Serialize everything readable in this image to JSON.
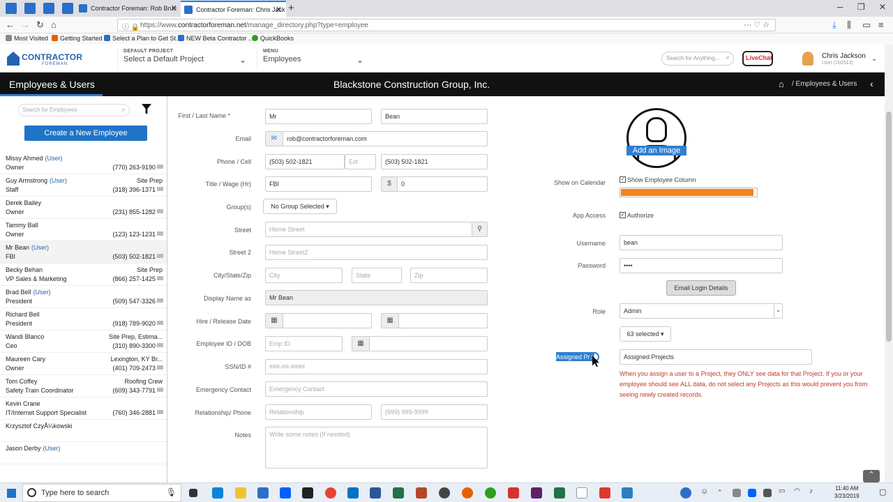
{
  "browser": {
    "tabs": [
      {
        "label": "Contractor Foreman: Rob Bruc",
        "active": false
      },
      {
        "label": "Contractor Foreman: Chris Jack",
        "active": true
      }
    ],
    "url_prefix": "https://www.",
    "url_host": "contractorforeman.net",
    "url_path": "/manage_directory.php?type=employee",
    "bookmarks": [
      "Most Visited",
      "Getting Started",
      "Select a Plan to Get St...",
      "NEW Beta Contractor ...",
      "QuickBooks"
    ]
  },
  "header": {
    "logo_text": "CONTRACTOR",
    "logo_sub": "FOREMAN",
    "project_caption": "DEFAULT PROJECT",
    "project_value": "Select a Default Project",
    "menu_caption": "MENU",
    "menu_value": "Employees",
    "search_placeholder": "Search for Anything...",
    "livechat": "LiveChat",
    "user_name": "Chris Jackson",
    "user_id": "User (102513)"
  },
  "titlebar": {
    "page_title": "Employees & Users",
    "company": "Blackstone Construction Group, Inc.",
    "breadcrumb": "/   Employees & Users"
  },
  "sidebar": {
    "search_placeholder": "Search for Employees",
    "create_button": "Create a New Employee",
    "user_tag": "(User)",
    "employees": [
      {
        "name": "Missy Ahmed",
        "user": true,
        "role": "Owner",
        "dept": "",
        "phone": "(770) 263-9190"
      },
      {
        "name": "Guy Armstrong",
        "user": true,
        "role": "Staff",
        "dept": "Site Prep",
        "phone": "(318) 396-1371"
      },
      {
        "name": "Derek Bailey",
        "user": false,
        "role": "Owner",
        "dept": "",
        "phone": "(231) 855-1282"
      },
      {
        "name": "Tammy Ball",
        "user": false,
        "role": "Owner",
        "dept": "",
        "phone": "(123) 123-1231"
      },
      {
        "name": "Mr Bean",
        "user": true,
        "role": "FBI",
        "dept": "",
        "phone": "(503) 502-1821",
        "selected": true
      },
      {
        "name": "Becky Behan",
        "user": false,
        "role": "VP Sales & Marketing",
        "dept": "Site Prep",
        "phone": "(866) 257-1425"
      },
      {
        "name": "Brad Bell",
        "user": true,
        "role": "President",
        "dept": "",
        "phone": "(509) 547-3326"
      },
      {
        "name": "Richard Bell",
        "user": false,
        "role": "President",
        "dept": "",
        "phone": "(918) 789-9020"
      },
      {
        "name": "Wandi Blanco",
        "user": false,
        "role": "Ceo",
        "dept": "Site Prep, Estima...",
        "phone": "(310) 890-3300"
      },
      {
        "name": "Maureen Cary",
        "user": false,
        "role": "Owner",
        "dept": "Lexington, KY Br...",
        "phone": "(401) 709-2473"
      },
      {
        "name": "Tom Coffey",
        "user": false,
        "role": "Safety Train Coordinator",
        "dept": "Roofing Crew",
        "phone": "(609) 343-7791"
      },
      {
        "name": "Kevin Crane",
        "user": false,
        "role": "IT/Internet Support Specialist",
        "dept": "",
        "phone": "(760) 346-2881"
      },
      {
        "name": "Krzysztof CzyÅ¼kowski",
        "user": false,
        "role": "",
        "dept": "",
        "phone": ""
      },
      {
        "name": "Jason Derby",
        "user": true,
        "role": "",
        "dept": "",
        "phone": ""
      }
    ]
  },
  "form": {
    "labels": {
      "name": "First /  Last Name *",
      "email": "Email",
      "phone": "Phone / Cell",
      "title": "Title / Wage (Hr)",
      "groups": "Group(s)",
      "street": "Street",
      "street2": "Street 2",
      "city": "City/State/Zip",
      "display": "Display Name as",
      "hire": "Hire / Release Date",
      "empid": "Employee ID / DOB",
      "ssn": "SSN/ID #",
      "emergency": "Emergency Contact",
      "relationship": "Relationship/ Phone",
      "notes": "Notes"
    },
    "first_name": "Mr",
    "last_name": "Bean",
    "email": "rob@contractorforeman.com",
    "phone": "(503) 502-1821",
    "ext_placeholder": "Ext",
    "cell": "(503) 502-1821",
    "title": "FBI",
    "wage_symbol": "$",
    "wage": "0",
    "groups_button": "No Group Selected",
    "street_placeholder": "Home Street",
    "street2_placeholder": "Home Street2",
    "city_placeholder": "City",
    "state_placeholder": "State",
    "zip_placeholder": "Zip",
    "display_name": "Mr Bean",
    "empid_placeholder": "Emp ID",
    "ssn_placeholder": "###-##-####",
    "emergency_placeholder": "Emergency Contact",
    "relationship_placeholder": "Relationship",
    "relationship_phone_placeholder": "(999) 999-9999",
    "notes_placeholder": "Write some notes (If needed)"
  },
  "right": {
    "add_image": "Add an Image",
    "show_calendar_label": "Show on Calendar",
    "show_column_text": "Show Employee Column",
    "calendar_color": "#f5821f",
    "app_access_label": "App Access",
    "authorize_text": "Authorize",
    "username_label": "Username",
    "username": "bean",
    "password_label": "Password",
    "password": "••••",
    "email_login_button": "Email Login Details",
    "role_label": "Role",
    "role": "Admin",
    "selected_button": "63 selected",
    "assigned_label": "Assigned Projects",
    "assigned_value": "Assigned Projects",
    "hint": "When you assign a user to a Project, they ONLY see data for that Project. If you or your employee should see ALL data, do not select any Projects as this would prevent you from seeing newly created records."
  },
  "taskbar": {
    "search_text": "Type here to search",
    "time": "11:40 AM",
    "date": "3/23/2019"
  }
}
